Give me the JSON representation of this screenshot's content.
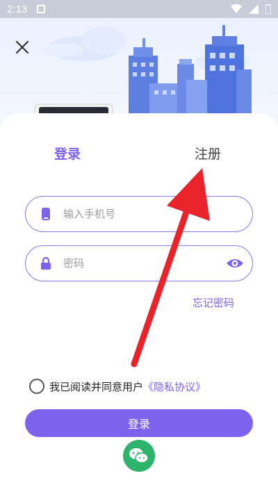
{
  "status_bar": {
    "time": "2:13"
  },
  "tabs": {
    "login": "登录",
    "register": "注册"
  },
  "phone_field": {
    "placeholder": "输入手机号",
    "value": ""
  },
  "password_field": {
    "placeholder": "密码",
    "value": ""
  },
  "forgot_password": "忘记密码",
  "agreement": {
    "text": "我已阅读并同意用户",
    "link": "《隐私协议》",
    "checked": false
  },
  "login_button": "登录",
  "icons": {
    "close": "close-icon",
    "phone": "phone-icon",
    "lock": "lock-icon",
    "eye": "eye-icon",
    "wechat": "wechat-icon"
  },
  "colors": {
    "accent": "#7b63ec",
    "wechat": "#2db36b",
    "arrow": "#e8232a"
  }
}
